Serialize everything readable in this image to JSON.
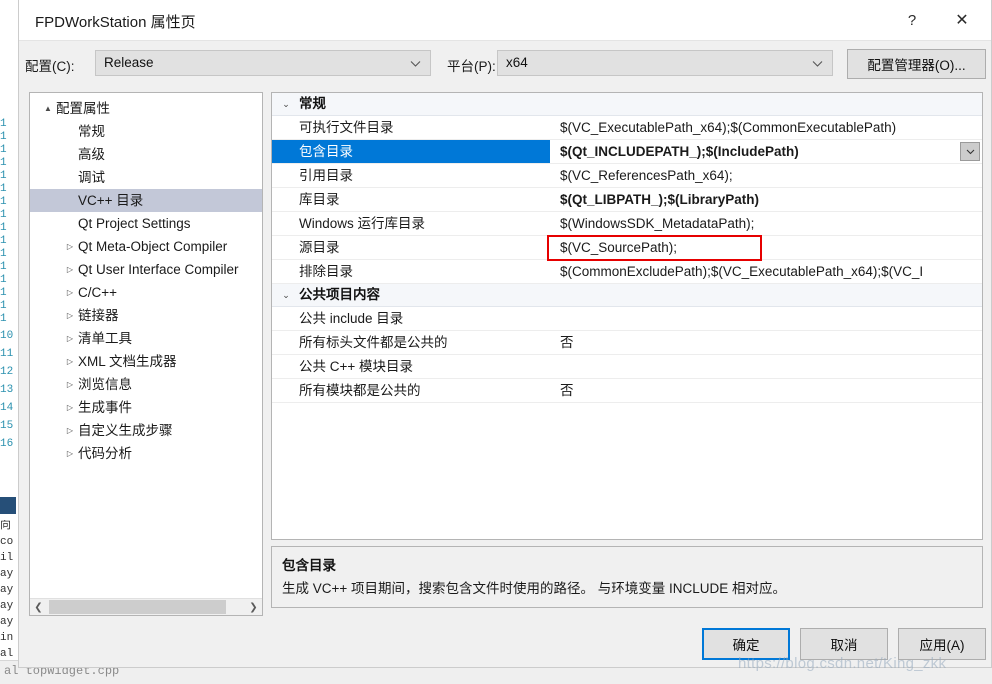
{
  "window": {
    "title": "FPDWorkStation 属性页",
    "help_button": "?",
    "close_button": "✕"
  },
  "config_bar": {
    "config_label": "配置(C):",
    "config_value": "Release",
    "platform_label": "平台(P):",
    "platform_value": "x64",
    "config_manager_button": "配置管理器(O)..."
  },
  "tree": {
    "items": [
      {
        "label": "配置属性",
        "level": 0,
        "arrow": "▲",
        "expanded": true,
        "selected": false
      },
      {
        "label": "常规",
        "level": 1,
        "arrow": "",
        "expanded": false,
        "selected": false
      },
      {
        "label": "高级",
        "level": 1,
        "arrow": "",
        "expanded": false,
        "selected": false
      },
      {
        "label": "调试",
        "level": 1,
        "arrow": "",
        "expanded": false,
        "selected": false
      },
      {
        "label": "VC++ 目录",
        "level": 1,
        "arrow": "",
        "expanded": false,
        "selected": true
      },
      {
        "label": "Qt Project Settings",
        "level": 1,
        "arrow": "",
        "expanded": false,
        "selected": false
      },
      {
        "label": "Qt Meta-Object Compiler",
        "level": 1,
        "arrow": "▷",
        "expanded": false,
        "selected": false
      },
      {
        "label": "Qt User Interface Compiler",
        "level": 1,
        "arrow": "▷",
        "expanded": false,
        "selected": false
      },
      {
        "label": "C/C++",
        "level": 1,
        "arrow": "▷",
        "expanded": false,
        "selected": false
      },
      {
        "label": "链接器",
        "level": 1,
        "arrow": "▷",
        "expanded": false,
        "selected": false
      },
      {
        "label": "清单工具",
        "level": 1,
        "arrow": "▷",
        "expanded": false,
        "selected": false
      },
      {
        "label": "XML 文档生成器",
        "level": 1,
        "arrow": "▷",
        "expanded": false,
        "selected": false
      },
      {
        "label": "浏览信息",
        "level": 1,
        "arrow": "▷",
        "expanded": false,
        "selected": false
      },
      {
        "label": "生成事件",
        "level": 1,
        "arrow": "▷",
        "expanded": false,
        "selected": false
      },
      {
        "label": "自定义生成步骤",
        "level": 1,
        "arrow": "▷",
        "expanded": false,
        "selected": false
      },
      {
        "label": "代码分析",
        "level": 1,
        "arrow": "▷",
        "expanded": false,
        "selected": false
      }
    ],
    "scrollbar": {
      "left_arrow": "❮",
      "right_arrow": "❯"
    }
  },
  "grid": {
    "groups": [
      {
        "category": "常规",
        "arrow": "⌄",
        "rows": [
          {
            "name": "可执行文件目录",
            "value": "$(VC_ExecutablePath_x64);$(CommonExecutablePath)",
            "bold": false,
            "selected": false,
            "dropdown": false
          },
          {
            "name": "包含目录",
            "value": "$(Qt_INCLUDEPATH_);$(IncludePath)",
            "bold": true,
            "selected": true,
            "dropdown": true
          },
          {
            "name": "引用目录",
            "value": "$(VC_ReferencesPath_x64);",
            "bold": false,
            "selected": false,
            "dropdown": false
          },
          {
            "name": "库目录",
            "value": "$(Qt_LIBPATH_);$(LibraryPath)",
            "bold": true,
            "selected": false,
            "dropdown": false
          },
          {
            "name": "Windows 运行库目录",
            "value": "$(WindowsSDK_MetadataPath);",
            "bold": false,
            "selected": false,
            "dropdown": false
          },
          {
            "name": "源目录",
            "value": "$(VC_SourcePath);",
            "bold": false,
            "selected": false,
            "dropdown": false
          },
          {
            "name": "排除目录",
            "value": "$(CommonExcludePath);$(VC_ExecutablePath_x64);$(VC_I",
            "bold": false,
            "selected": false,
            "dropdown": false
          }
        ]
      },
      {
        "category": "公共项目内容",
        "arrow": "⌄",
        "rows": [
          {
            "name": "公共 include 目录",
            "value": "",
            "bold": false,
            "selected": false,
            "dropdown": false
          },
          {
            "name": "所有标头文件都是公共的",
            "value": "否",
            "bold": false,
            "selected": false,
            "dropdown": false
          },
          {
            "name": "公共 C++ 模块目录",
            "value": "",
            "bold": false,
            "selected": false,
            "dropdown": false
          },
          {
            "name": "所有模块都是公共的",
            "value": "否",
            "bold": false,
            "selected": false,
            "dropdown": false
          }
        ]
      }
    ],
    "highlight_color": "#e60000",
    "selection_color": "#0078d7"
  },
  "description": {
    "title": "包含目录",
    "body": "生成 VC++ 项目期间，搜索包含文件时使用的路径。 与环境变量 INCLUDE 相对应。"
  },
  "footer": {
    "ok": "确定",
    "cancel": "取消",
    "apply": "应用(A)"
  },
  "background": {
    "line_numbers": [
      "1",
      "1",
      "1",
      "1",
      "1",
      "1",
      "1",
      "1",
      "1",
      "1",
      "1",
      "1",
      "1",
      "1",
      "1",
      "1"
    ],
    "numbers_lower": [
      "10",
      "11",
      "12",
      "13",
      "14",
      "15",
      "16"
    ],
    "code_fragments": [
      "向",
      "co",
      "il",
      "ay",
      "ay",
      "ay",
      "ay",
      "in",
      "al"
    ],
    "bottom_code": "al topWidget.cpp"
  },
  "watermark": "https://blog.csdn.net/King_zkk"
}
